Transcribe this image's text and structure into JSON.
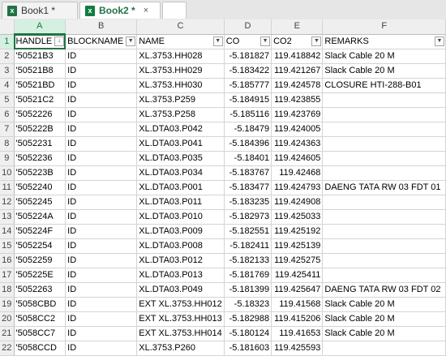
{
  "tabs": [
    {
      "label": "Book1 *",
      "icon": "excel-icon"
    },
    {
      "label": "Book2 *",
      "icon": "excel-icon",
      "close": "×"
    },
    {
      "label": ""
    }
  ],
  "columns": [
    "A",
    "B",
    "C",
    "D",
    "E",
    "F"
  ],
  "headers": {
    "A": "HANDLE",
    "B": "BLOCKNAME",
    "C": "NAME",
    "D": "CO",
    "E": "CO2",
    "F": "REMARKS",
    "sorted_indicator": "↓"
  },
  "row_numbers": [
    "1",
    "2",
    "3",
    "4",
    "5",
    "6",
    "7",
    "8",
    "9",
    "10",
    "11",
    "12",
    "13",
    "14",
    "15",
    "16",
    "17",
    "18",
    "19",
    "20",
    "21",
    "22"
  ],
  "rows": [
    {
      "handle": "'50521B3",
      "block": "ID",
      "name": "XL.3753.HH028",
      "co": "-5.181827",
      "co2": "119.418842",
      "remarks": "Slack Cable 20 M"
    },
    {
      "handle": "'50521B8",
      "block": "ID",
      "name": "XL.3753.HH029",
      "co": "-5.183422",
      "co2": "119.421267",
      "remarks": "Slack Cable 20 M"
    },
    {
      "handle": "'50521BD",
      "block": "ID",
      "name": "XL.3753.HH030",
      "co": "-5.185777",
      "co2": "119.424578",
      "remarks": "CLOSURE HTI-288-B01"
    },
    {
      "handle": "'50521C2",
      "block": "ID",
      "name": "XL.3753.P259",
      "co": "-5.184915",
      "co2": "119.423855",
      "remarks": ""
    },
    {
      "handle": "'5052226",
      "block": "ID",
      "name": "XL.3753.P258",
      "co": "-5.185116",
      "co2": "119.423769",
      "remarks": ""
    },
    {
      "handle": "'505222B",
      "block": "ID",
      "name": "XL.DTA03.P042",
      "co": "-5.18479",
      "co2": "119.424005",
      "remarks": ""
    },
    {
      "handle": "'5052231",
      "block": "ID",
      "name": "XL.DTA03.P041",
      "co": "-5.184396",
      "co2": "119.424363",
      "remarks": ""
    },
    {
      "handle": "'5052236",
      "block": "ID",
      "name": "XL.DTA03.P035",
      "co": "-5.18401",
      "co2": "119.424605",
      "remarks": ""
    },
    {
      "handle": "'505223B",
      "block": "ID",
      "name": "XL.DTA03.P034",
      "co": "-5.183767",
      "co2": "119.42468",
      "remarks": ""
    },
    {
      "handle": "'5052240",
      "block": "ID",
      "name": "XL.DTA03.P001",
      "co": "-5.183477",
      "co2": "119.424793",
      "remarks": "DAENG TATA RW 03 FDT 01"
    },
    {
      "handle": "'5052245",
      "block": "ID",
      "name": "XL.DTA03.P011",
      "co": "-5.183235",
      "co2": "119.424908",
      "remarks": ""
    },
    {
      "handle": "'505224A",
      "block": "ID",
      "name": "XL.DTA03.P010",
      "co": "-5.182973",
      "co2": "119.425033",
      "remarks": ""
    },
    {
      "handle": "'505224F",
      "block": "ID",
      "name": "XL.DTA03.P009",
      "co": "-5.182551",
      "co2": "119.425192",
      "remarks": ""
    },
    {
      "handle": "'5052254",
      "block": "ID",
      "name": "XL.DTA03.P008",
      "co": "-5.182411",
      "co2": "119.425139",
      "remarks": ""
    },
    {
      "handle": "'5052259",
      "block": "ID",
      "name": "XL.DTA03.P012",
      "co": "-5.182133",
      "co2": "119.425275",
      "remarks": ""
    },
    {
      "handle": "'505225E",
      "block": "ID",
      "name": "XL.DTA03.P013",
      "co": "-5.181769",
      "co2": "119.425411",
      "remarks": ""
    },
    {
      "handle": "'5052263",
      "block": "ID",
      "name": "XL.DTA03.P049",
      "co": "-5.181399",
      "co2": "119.425647",
      "remarks": "DAENG TATA RW 03 FDT 02"
    },
    {
      "handle": "'5058CBD",
      "block": "ID",
      "name": "EXT XL.3753.HH012",
      "co": "-5.18323",
      "co2": "119.41568",
      "remarks": "Slack Cable 20 M"
    },
    {
      "handle": "'5058CC2",
      "block": "ID",
      "name": "EXT XL.3753.HH013",
      "co": "-5.182988",
      "co2": "119.415206",
      "remarks": "Slack Cable 20 M"
    },
    {
      "handle": "'5058CC7",
      "block": "ID",
      "name": "EXT XL.3753.HH014",
      "co": "-5.180124",
      "co2": "119.41653",
      "remarks": "Slack Cable 20 M"
    },
    {
      "handle": "'5058CCD",
      "block": "ID",
      "name": "XL.3753.P260",
      "co": "-5.181603",
      "co2": "119.425593",
      "remarks": ""
    }
  ],
  "colors": {
    "accent": "#217346",
    "selected_header": "#d3f0e0"
  }
}
